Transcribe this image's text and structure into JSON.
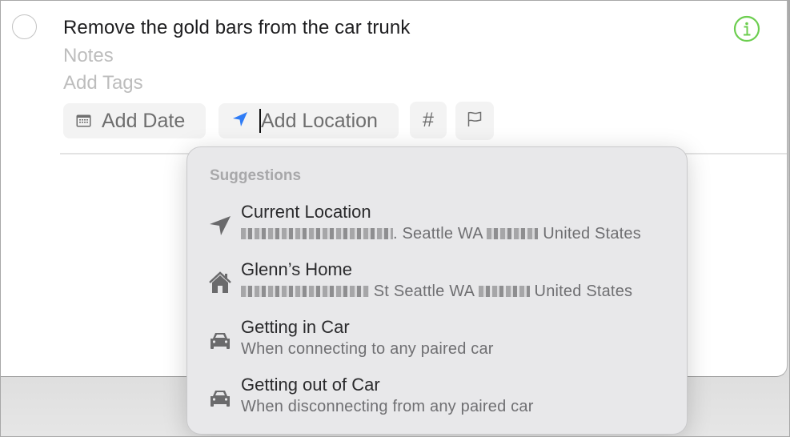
{
  "task": {
    "title": "Remove the gold bars from the car trunk",
    "notes_placeholder": "Notes",
    "tags_placeholder": "Add Tags",
    "completed": false
  },
  "toolbar": {
    "add_date_label": "Add Date",
    "add_location_label": "Add Location",
    "tag_symbol": "#",
    "flag_icon": "flag-icon",
    "date_icon": "calendar-icon",
    "location_icon": "location-arrow-icon"
  },
  "info_icon": "info-icon",
  "colors": {
    "info_green": "#6cce4f",
    "location_blue": "#2f7cf6"
  },
  "suggestions": {
    "heading": "Suggestions",
    "items": [
      {
        "icon": "location-arrow-icon",
        "name": "Current Location",
        "detail_redacted": true,
        "detail_middle": ". Seattle WA",
        "detail_end": "United States"
      },
      {
        "icon": "home-icon",
        "name": "Glenn’s Home",
        "detail_redacted": true,
        "detail_middle": "St Seattle WA",
        "detail_end": "United States"
      },
      {
        "icon": "car-icon",
        "name": "Getting in Car",
        "detail": "When connecting to any paired car"
      },
      {
        "icon": "car-icon",
        "name": "Getting out of Car",
        "detail": "When disconnecting from any paired car"
      }
    ]
  }
}
